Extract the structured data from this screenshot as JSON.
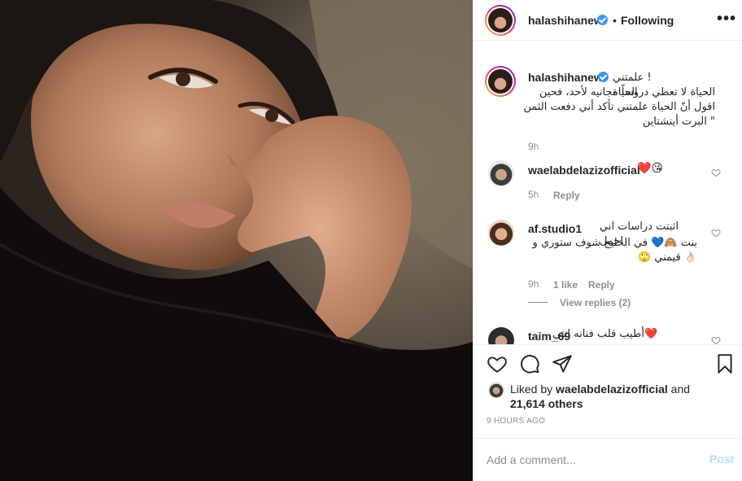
{
  "post": {
    "author": "halashihanew",
    "follow_separator": "•",
    "follow_status": "Following",
    "more_icon": "more-horizontal-icon",
    "more_label": "•••"
  },
  "caption": {
    "username": "halashihanew",
    "text_first": "! علمتني الحياة",
    "text_body": "الحياة لا تعطي دروساً مجانيه لأحد، فحين اقول أنّ الحياة علمتني تأكد أني دفعت الثمن \" البرت أينشتاين",
    "time": "9h"
  },
  "comments": [
    {
      "username": "waelabdelazizofficial",
      "text": "❤️😘",
      "time": "5h",
      "reply_label": "Reply"
    },
    {
      "username": "af.studio1",
      "text_first": "اثبتت دراسات اني اجمل",
      "text_body": "بنت 🙈💙 في الخليج شوف ستوري و 👌🏻 قيمني 🙄",
      "time": "9h",
      "likes": "1 like",
      "reply_label": "Reply",
      "view_replies": "View replies (2)"
    },
    {
      "username": "taim_69",
      "text": "❤️أطيب قلب فنانه انتي"
    }
  ],
  "likes": {
    "prefix": "Liked by ",
    "user": "waelabdelazizofficial",
    "middle": " and",
    "count": "21,614 others"
  },
  "timestamp": "9 HOURS AGO",
  "add_comment": {
    "placeholder": "Add a comment...",
    "post_label": "Post"
  },
  "colors": {
    "verified": "#3897f0",
    "secondary_text": "#8e8e8e",
    "post_disabled": "#b2dffc",
    "heart_red": "#ed4956"
  }
}
